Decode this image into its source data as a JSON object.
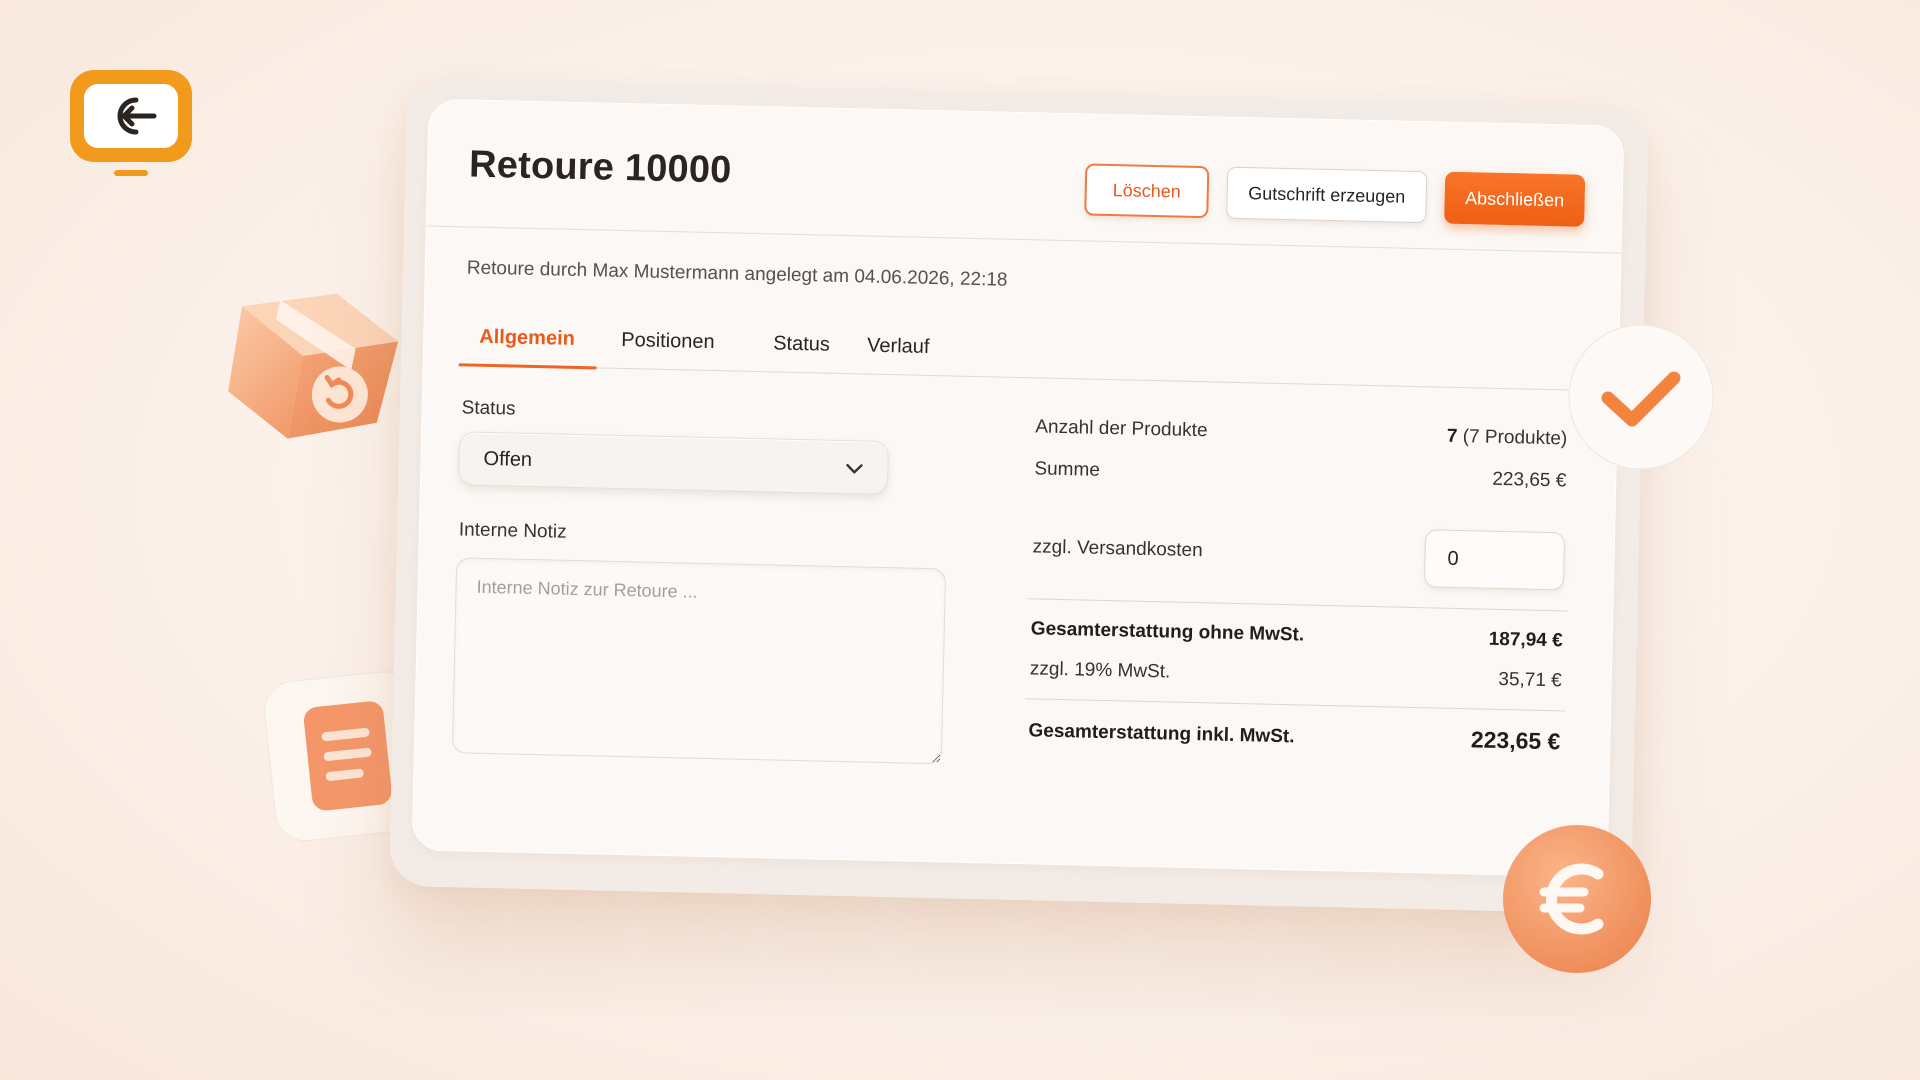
{
  "colors": {
    "accent": "#ef6420",
    "accent_dark": "#e8581a",
    "logo": "#f29a1c",
    "background": "#fbf1ea"
  },
  "logo": {
    "icon": "return-arrow-icon"
  },
  "header": {
    "title": "Retoure 10000",
    "buttons": {
      "delete": "Löschen",
      "credit_note": "Gutschrift erzeugen",
      "complete": "Abschließen"
    }
  },
  "meta_line": "Retoure durch Max Mustermann angelegt am 04.06.2026, 22:18",
  "tabs": [
    {
      "label": "Allgemein",
      "active": true
    },
    {
      "label": "Positionen",
      "active": false
    },
    {
      "label": "Status",
      "active": false
    },
    {
      "label": "Verlauf",
      "active": false
    }
  ],
  "form": {
    "status_label": "Status",
    "status_value": "Offen",
    "note_label": "Interne Notiz",
    "note_placeholder": "Interne Notiz zur Retoure ..."
  },
  "summary": {
    "product_count_label": "Anzahl der Produkte",
    "product_count_value": "7",
    "product_count_note": "(7 Produkte)",
    "sum_label": "Summe",
    "sum_value": "223,65 €",
    "shipping_label": "zzgl. Versandkosten",
    "shipping_value": "0",
    "net_label": "Gesamterstattung ohne MwSt.",
    "net_value": "187,94 €",
    "vat_label": "zzgl. 19% MwSt.",
    "vat_value": "35,71 €",
    "gross_label": "Gesamterstattung inkl. MwSt.",
    "gross_value": "223,65 €"
  },
  "decorations": {
    "box": "return-package-icon",
    "document": "document-icon",
    "check": "checkmark-icon",
    "euro": "euro-coin-icon"
  }
}
